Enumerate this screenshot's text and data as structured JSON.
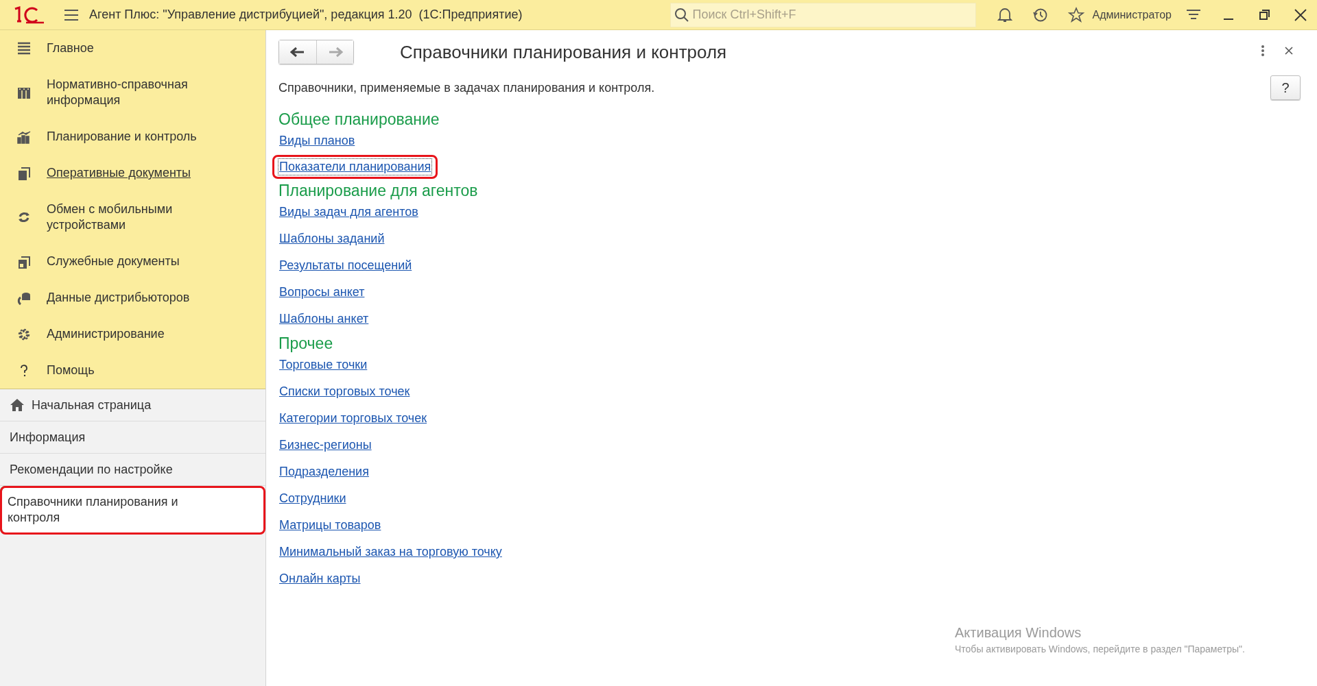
{
  "app": {
    "title": "Агент Плюс: \"Управление дистрибуцией\", редакция 1.20  (1С:Предприятие)",
    "search": {
      "placeholder": "Поиск Ctrl+Shift+F"
    },
    "user": "Администратор"
  },
  "sections": [
    {
      "label": "Главное",
      "hovered": false
    },
    {
      "label": "Нормативно-справочная информация",
      "hovered": false
    },
    {
      "label": "Планирование и контроль",
      "hovered": false
    },
    {
      "label": "Оперативные документы",
      "hovered": true
    },
    {
      "label": "Обмен с мобильными устройствами",
      "hovered": false
    },
    {
      "label": "Служебные документы",
      "hovered": false
    },
    {
      "label": "Данные дистрибьюторов",
      "hovered": false
    },
    {
      "label": "Администрирование",
      "hovered": false
    },
    {
      "label": "Помощь",
      "hovered": false
    }
  ],
  "open_pages": [
    {
      "kind": "home",
      "label": "Начальная страница",
      "selected": false,
      "highlighted": false
    },
    {
      "kind": "page",
      "label": "Информация",
      "selected": false,
      "highlighted": false
    },
    {
      "kind": "page",
      "label": "Рекомендации по настройке",
      "selected": false,
      "highlighted": false
    },
    {
      "kind": "page",
      "label": "Справочники планирования и контроля",
      "selected": true,
      "highlighted": true
    }
  ],
  "form": {
    "title": "Справочники планирования и контроля",
    "description": "Справочники, применяемые в задачах планирования и контроля.",
    "help_button": "?",
    "groups": [
      {
        "heading": "Общее планирование",
        "links": [
          {
            "label": "Виды планов",
            "focused": false,
            "highlighted": false
          },
          {
            "label": "Показатели планирования",
            "focused": true,
            "highlighted": true
          }
        ]
      },
      {
        "heading": "Планирование для агентов",
        "links": [
          {
            "label": "Виды задач для агентов",
            "focused": false,
            "highlighted": false
          },
          {
            "label": "Шаблоны заданий",
            "focused": false,
            "highlighted": false
          },
          {
            "label": "Результаты посещений",
            "focused": false,
            "highlighted": false
          },
          {
            "label": "Вопросы анкет",
            "focused": false,
            "highlighted": false
          },
          {
            "label": "Шаблоны анкет",
            "focused": false,
            "highlighted": false
          }
        ]
      },
      {
        "heading": "Прочее",
        "links": [
          {
            "label": "Торговые точки",
            "focused": false,
            "highlighted": false
          },
          {
            "label": "Списки торговых точек",
            "focused": false,
            "highlighted": false
          },
          {
            "label": "Категории торговых точек",
            "focused": false,
            "highlighted": false
          },
          {
            "label": "Бизнес-регионы",
            "focused": false,
            "highlighted": false
          },
          {
            "label": "Подразделения",
            "focused": false,
            "highlighted": false
          },
          {
            "label": "Сотрудники",
            "focused": false,
            "highlighted": false
          },
          {
            "label": "Матрицы товаров",
            "focused": false,
            "highlighted": false
          },
          {
            "label": "Минимальный заказ на торговую точку",
            "focused": false,
            "highlighted": false
          },
          {
            "label": "Онлайн карты",
            "focused": false,
            "highlighted": false
          }
        ]
      }
    ]
  },
  "os_notice": {
    "title": "Активация Windows",
    "message": "Чтобы активировать Windows, перейдите в раздел \"Параметры\"."
  }
}
